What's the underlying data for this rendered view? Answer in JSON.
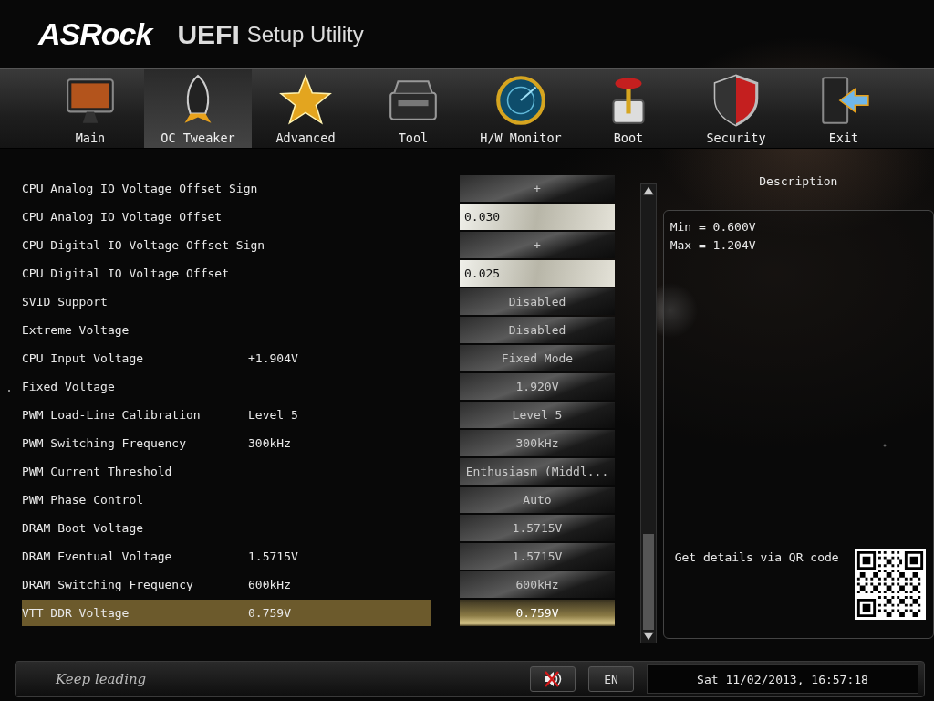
{
  "header": {
    "brand": "ASRock",
    "product": "UEFI",
    "subtitle": "Setup Utility"
  },
  "tabs": [
    {
      "label": "Main",
      "selected": false
    },
    {
      "label": "OC Tweaker",
      "selected": true
    },
    {
      "label": "Advanced",
      "selected": false
    },
    {
      "label": "Tool",
      "selected": false
    },
    {
      "label": "H/W Monitor",
      "selected": false
    },
    {
      "label": "Boot",
      "selected": false
    },
    {
      "label": "Security",
      "selected": false
    },
    {
      "label": "Exit",
      "selected": false
    }
  ],
  "settings": [
    {
      "label": "CPU Analog IO Voltage Offset Sign",
      "value": "+",
      "kind": "option",
      "selected": false
    },
    {
      "label": "CPU Analog IO Voltage Offset",
      "value": "0.030",
      "kind": "field",
      "selected": false
    },
    {
      "label": "CPU Digital IO Voltage Offset Sign",
      "value": "+",
      "kind": "option",
      "selected": false
    },
    {
      "label": "CPU Digital IO Voltage Offset",
      "value": "0.025",
      "kind": "field",
      "selected": false
    },
    {
      "label": "SVID Support",
      "value": "Disabled",
      "kind": "option",
      "selected": false
    },
    {
      "label": "Extreme Voltage",
      "value": "Disabled",
      "kind": "option",
      "selected": false
    },
    {
      "label": "CPU Input Voltage",
      "current": "+1.904V",
      "value": "Fixed Mode",
      "kind": "option",
      "selected": false
    },
    {
      "label": "Fixed Voltage",
      "value": "1.920V",
      "kind": "option",
      "selected": false
    },
    {
      "label": "PWM Load-Line Calibration",
      "current": "Level 5",
      "value": "Level 5",
      "kind": "option",
      "selected": false
    },
    {
      "label": "PWM Switching Frequency",
      "current": "300kHz",
      "value": "300kHz",
      "kind": "option",
      "selected": false
    },
    {
      "label": "PWM Current Threshold",
      "value": "Enthusiasm (Middl...",
      "kind": "option",
      "selected": false
    },
    {
      "label": "PWM Phase Control",
      "value": "Auto",
      "kind": "option",
      "selected": false
    },
    {
      "label": "DRAM Boot Voltage",
      "value": "1.5715V",
      "kind": "option",
      "selected": false
    },
    {
      "label": "DRAM Eventual Voltage",
      "current": "1.5715V",
      "value": "1.5715V",
      "kind": "option",
      "selected": false
    },
    {
      "label": "DRAM Switching Frequency",
      "current": "600kHz",
      "value": "600kHz",
      "kind": "option",
      "selected": false
    },
    {
      "label": "VTT DDR Voltage",
      "current": "0.759V",
      "value": "0.759V",
      "kind": "option",
      "selected": true
    }
  ],
  "description": {
    "title": "Description",
    "lines": [
      "Min = 0.600V",
      "Max = 1.204V"
    ],
    "qr_caption": "Get details via QR code"
  },
  "footer": {
    "slogan": "Keep leading",
    "language": "EN",
    "datetime": "Sat 11/02/2013, 16:57:18"
  }
}
